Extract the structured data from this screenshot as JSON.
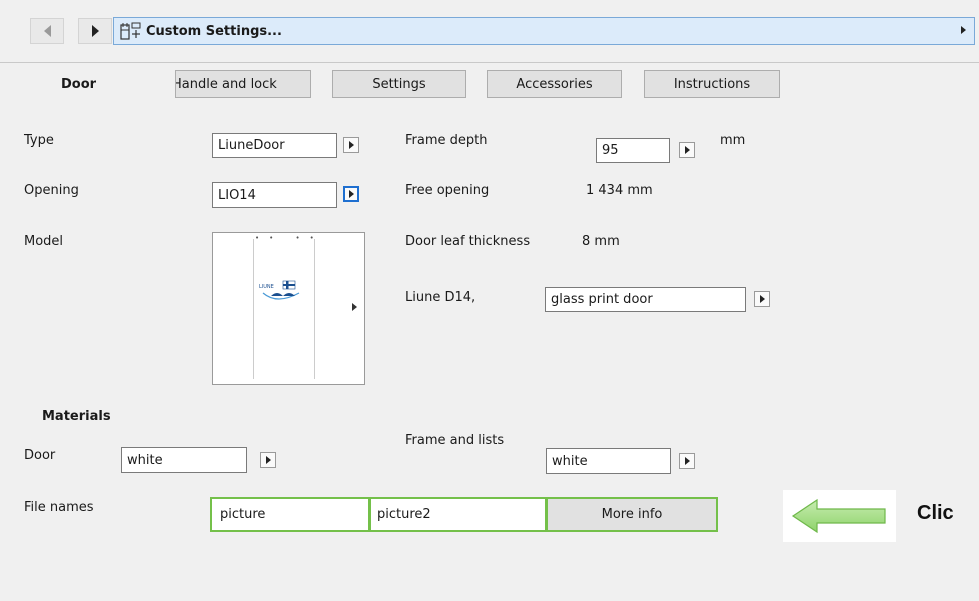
{
  "toolbar": {
    "title": "Custom Settings...",
    "back_icon": "triangle-left-icon",
    "forward_icon": "triangle-right-icon",
    "settings_icon": "custom-settings-icon",
    "expand_icon": "triangle-right-icon"
  },
  "tabs": {
    "section_label": "Door",
    "items": [
      {
        "label": "Handle and lock"
      },
      {
        "label": "Settings"
      },
      {
        "label": "Accessories"
      },
      {
        "label": "Instructions"
      }
    ]
  },
  "door": {
    "type_label": "Type",
    "type_value": "LiuneDoor",
    "opening_label": "Opening",
    "opening_value": "LIO14",
    "model_label": "Model",
    "model_logo_text": "LIUNE"
  },
  "frame": {
    "depth_label": "Frame depth",
    "depth_value": "95",
    "depth_unit": "mm",
    "free_opening_label": "Free opening",
    "free_opening_value": "1 434 mm",
    "leaf_label": "Door leaf thickness",
    "leaf_value": "8 mm",
    "model_name_label": "Liune D14,",
    "model_variant": "glass print door"
  },
  "materials": {
    "section_label": "Materials",
    "door_label": "Door",
    "door_value": "white",
    "frame_label": "Frame and lists",
    "frame_value": "white"
  },
  "files": {
    "label": "File names",
    "picture1": "picture",
    "picture2": "picture2",
    "more_info": "More info"
  },
  "callout": {
    "text": "Clic",
    "arrow_color": "#8ed36a"
  },
  "colors": {
    "accent_blue": "#1e6fd0",
    "title_bg": "#dcebfa",
    "highlight_green": "#74c04a"
  }
}
